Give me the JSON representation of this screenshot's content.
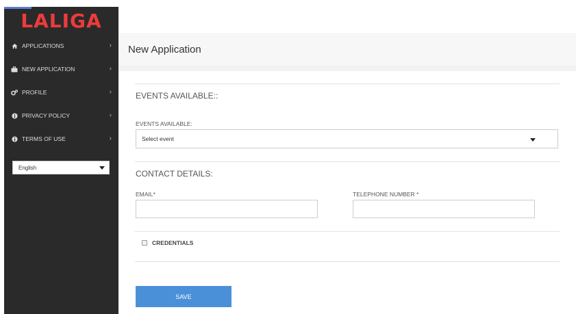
{
  "brand": {
    "logo_text": "LALIGA"
  },
  "sidebar": {
    "items": [
      {
        "label": "APPLICATIONS",
        "icon": "home-icon"
      },
      {
        "label": "NEW APPLICATION",
        "icon": "briefcase-icon"
      },
      {
        "label": "PROFILE",
        "icon": "gears-icon"
      },
      {
        "label": "PRIVACY POLICY",
        "icon": "info-icon"
      },
      {
        "label": "TERMS OF USE",
        "icon": "info-icon"
      }
    ],
    "language": {
      "selected": "English"
    }
  },
  "header": {
    "title": "New Application"
  },
  "form": {
    "events_section_title": "EVENTS AVAILABLE::",
    "events_label": "EVENTS AVAILABLE:",
    "events_select_value": "Select event",
    "contact_section_title": "CONTACT DETAILS:",
    "email_label": "EMAIL*",
    "email_value": "",
    "telephone_label": "TELEPHONE NUMBER *",
    "telephone_value": "",
    "credentials_label": "CREDENTIALS",
    "credentials_checked": false,
    "save_label": "SAVE"
  },
  "colors": {
    "sidebar_bg": "#2a2a2a",
    "logo_red": "#ee3b3b",
    "save_button": "#4a90d9"
  }
}
